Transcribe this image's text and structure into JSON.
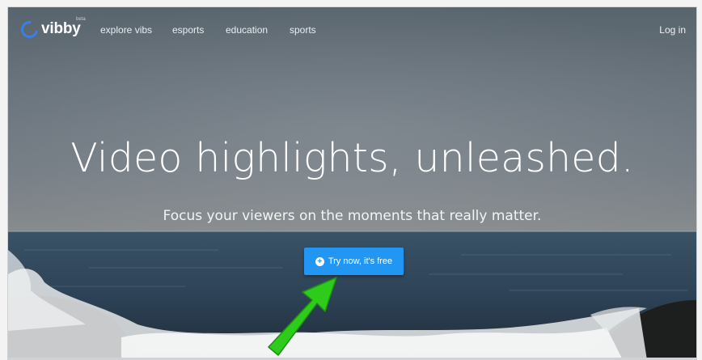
{
  "brand": {
    "name": "vibby",
    "tag": "beta"
  },
  "nav": {
    "links": [
      "explore vibs",
      "esports",
      "education",
      "sports"
    ],
    "login": "Log in"
  },
  "hero": {
    "headline": "Video highlights, unleashed.",
    "subhead": "Focus your viewers on the moments that really matter.",
    "cta_label": "Try now, it's free",
    "cta_icon": "plus-circle-icon"
  },
  "annotation": {
    "arrow_color": "#2ecc1a"
  },
  "colors": {
    "accent": "#2196f3",
    "logo": "#3b7ee8"
  }
}
